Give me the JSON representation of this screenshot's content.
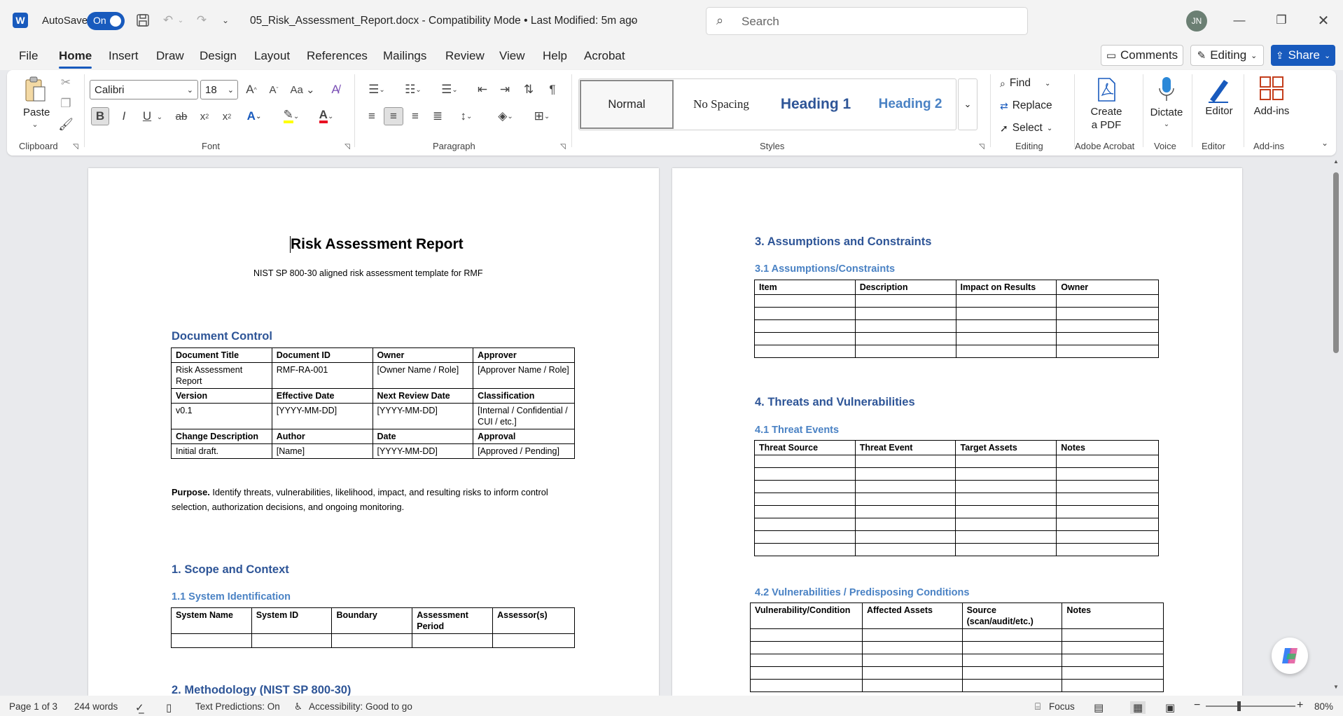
{
  "titlebar": {
    "autosave_label": "AutoSave",
    "autosave_state": "On",
    "doc_title": "05_Risk_Assessment_Report.docx  -  Compatibility Mode  •  Last Modified: 5m ago",
    "search_placeholder": "Search",
    "user_initials": "JN"
  },
  "menu": {
    "tabs": [
      "File",
      "Home",
      "Insert",
      "Draw",
      "Design",
      "Layout",
      "References",
      "Mailings",
      "Review",
      "View",
      "Help",
      "Acrobat"
    ],
    "comments_label": "Comments",
    "editing_label": "Editing",
    "share_label": "Share"
  },
  "ribbon": {
    "paste_label": "Paste",
    "font_name": "Calibri",
    "font_size": "18",
    "styles": [
      "Normal",
      "No Spacing",
      "Heading 1",
      "Heading 2"
    ],
    "find_label": "Find",
    "replace_label": "Replace",
    "select_label": "Select",
    "create_pdf_label": "Create a PDF",
    "dictate_label": "Dictate",
    "editor_label": "Editor",
    "addins_label": "Add-ins",
    "groups": {
      "clipboard": "Clipboard",
      "font": "Font",
      "paragraph": "Paragraph",
      "styles": "Styles",
      "editing": "Editing",
      "adobe": "Adobe Acrobat",
      "voice": "Voice",
      "editor": "Editor",
      "addins": "Add-ins"
    },
    "colors": {
      "accent": "#185abd",
      "highlight": "#ffff00",
      "font_color": "#e81123"
    }
  },
  "document": {
    "title": "Risk Assessment Report",
    "subtitle": "NIST SP 800-30 aligned risk assessment template for RMF",
    "doc_control_heading": "Document Control",
    "doc_control_table": [
      [
        "Document Title",
        "Document ID",
        "Owner",
        "Approver"
      ],
      [
        "Risk Assessment Report",
        "RMF-RA-001",
        "[Owner Name / Role]",
        "[Approver Name / Role]"
      ],
      [
        "Version",
        "Effective Date",
        "Next Review Date",
        "Classification"
      ],
      [
        "v0.1",
        "[YYYY-MM-DD]",
        "[YYYY-MM-DD]",
        "[Internal / Confidential / CUI / etc.]"
      ],
      [
        "Change Description",
        "Author",
        "Date",
        "Approval"
      ],
      [
        "Initial draft.",
        "[Name]",
        "[YYYY-MM-DD]",
        "[Approved / Pending]"
      ]
    ],
    "purpose_label": "Purpose.",
    "purpose_text": " Identify threats, vulnerabilities, likelihood, impact, and resulting risks to inform control selection, authorization decisions, and ongoing monitoring.",
    "sec1_heading": "1. Scope and Context",
    "sec1_1_heading": "1.1 System Identification",
    "sys_id_headers": [
      "System Name",
      "System ID",
      "Boundary",
      "Assessment Period",
      "Assessor(s)"
    ],
    "sec2_heading": "2. Methodology (NIST SP 800-30)",
    "sec3_heading": "3. Assumptions and Constraints",
    "sec3_1_heading": "3.1 Assumptions/Constraints",
    "assumptions_headers": [
      "Item",
      "Description",
      "Impact on Results",
      "Owner"
    ],
    "sec4_heading": "4. Threats and Vulnerabilities",
    "sec4_1_heading": "4.1 Threat Events",
    "threat_headers": [
      "Threat Source",
      "Threat Event",
      "Target Assets",
      "Notes"
    ],
    "sec4_2_heading": "4.2 Vulnerabilities / Predisposing Conditions",
    "vuln_headers": [
      "Vulnerability/Condition",
      "Affected Assets",
      "Source (scan/audit/etc.)",
      "Notes"
    ]
  },
  "statusbar": {
    "page": "Page 1 of 3",
    "words": "244 words",
    "text_predictions": "Text Predictions: On",
    "accessibility": "Accessibility: Good to go",
    "focus": "Focus",
    "zoom": "80%"
  }
}
